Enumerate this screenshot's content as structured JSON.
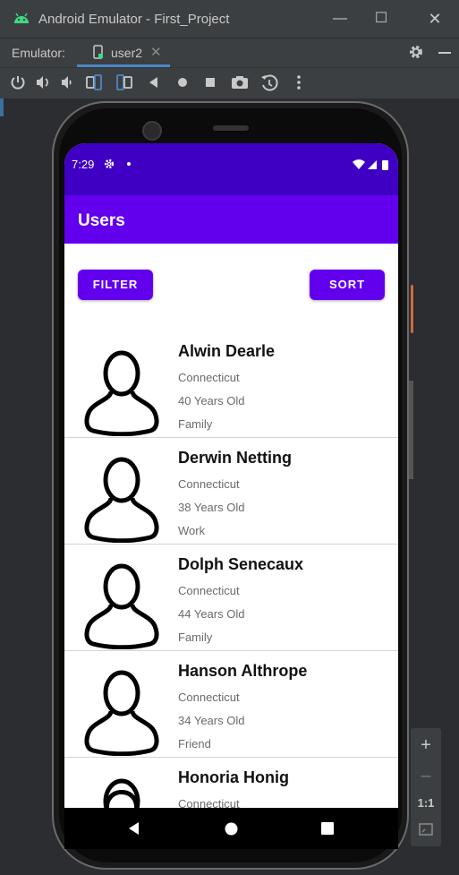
{
  "window": {
    "title": "Android Emulator - First_Project"
  },
  "tabbar": {
    "label": "Emulator:",
    "active_tab": "user2"
  },
  "device": {
    "status_time": "7:29",
    "app_title": "Users",
    "buttons": {
      "filter": "FILTER",
      "sort": "SORT"
    },
    "users": [
      {
        "name": "Alwin Dearle",
        "state": "Connecticut",
        "age": "40 Years Old",
        "group": "Family"
      },
      {
        "name": "Derwin Netting",
        "state": "Connecticut",
        "age": "38 Years Old",
        "group": "Work"
      },
      {
        "name": "Dolph Senecaux",
        "state": "Connecticut",
        "age": "44 Years Old",
        "group": "Family"
      },
      {
        "name": "Hanson Althrope",
        "state": "Connecticut",
        "age": "34 Years Old",
        "group": "Friend"
      },
      {
        "name": "Honoria Honig",
        "state": "Connecticut",
        "age": "",
        "group": ""
      }
    ]
  },
  "zoom": {
    "ratio": "1:1"
  },
  "colors": {
    "status_bar": "#3f00c4",
    "app_bar": "#6200ee",
    "button": "#6200ee"
  },
  "icons": [
    "android-icon",
    "device-icon",
    "gear-icon",
    "power-icon",
    "volume-up-icon",
    "volume-down-icon",
    "rotate-left-icon",
    "rotate-right-icon",
    "back-icon",
    "home-icon",
    "overview-icon",
    "camera-icon",
    "snapshot-icon",
    "more-icon",
    "person-icon",
    "wifi-icon",
    "signal-icon",
    "battery-icon",
    "zoom-in-icon",
    "zoom-out-icon",
    "fit-screen-icon"
  ]
}
